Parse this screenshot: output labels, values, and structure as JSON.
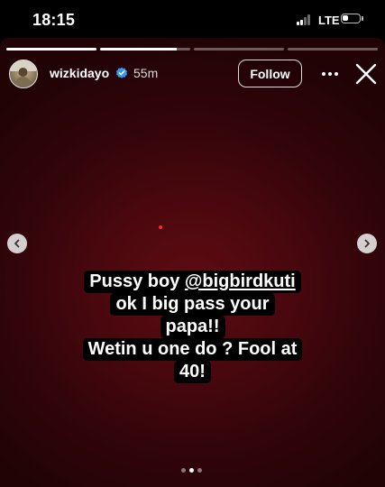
{
  "status_bar": {
    "time": "18:15",
    "network": "LTE",
    "signal_icon": "cellular-signal-icon",
    "battery_icon": "battery-icon",
    "battery_level": 0.35
  },
  "story": {
    "segments_total": 4,
    "active_segment": 2,
    "active_progress": 0.85,
    "background_color": "#4a080e",
    "accent_dot_color": "#ff2a2a"
  },
  "header": {
    "username": "wizkidayo",
    "verified_icon": "verified-badge-icon",
    "time_ago": "55m",
    "follow_label": "Follow",
    "more_icon": "more-options-icon",
    "close_icon": "close-icon"
  },
  "caption": {
    "line1_prefix": "Pussy boy ",
    "mention": "@bigbirdkuti",
    "line2": "ok I big pass your",
    "line3": "papa!!",
    "line4": "Wetin u one do ? Fool at",
    "line5": "40!"
  },
  "navigation": {
    "prev_icon": "chevron-left-icon",
    "next_icon": "chevron-right-icon"
  },
  "pagination": {
    "count": 3,
    "active_index": 1
  }
}
